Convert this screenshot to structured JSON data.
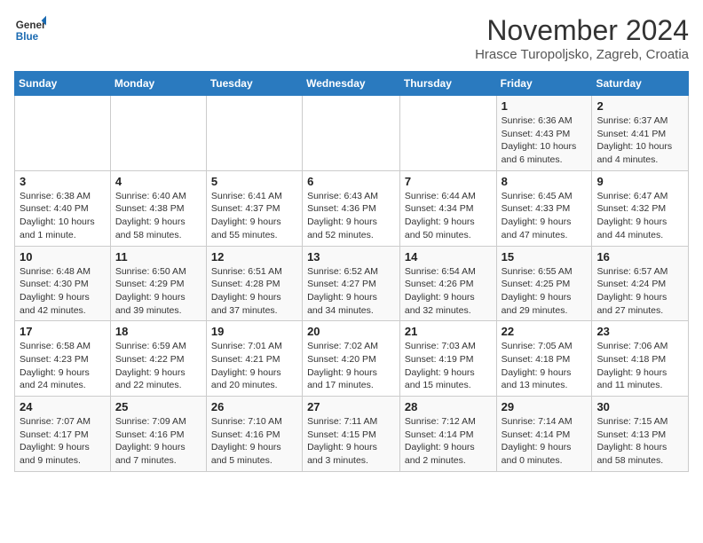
{
  "header": {
    "logo_line1": "General",
    "logo_line2": "Blue",
    "month": "November 2024",
    "location": "Hrasce Turopoljsko, Zagreb, Croatia"
  },
  "days_of_week": [
    "Sunday",
    "Monday",
    "Tuesday",
    "Wednesday",
    "Thursday",
    "Friday",
    "Saturday"
  ],
  "weeks": [
    [
      {
        "day": "",
        "info": ""
      },
      {
        "day": "",
        "info": ""
      },
      {
        "day": "",
        "info": ""
      },
      {
        "day": "",
        "info": ""
      },
      {
        "day": "",
        "info": ""
      },
      {
        "day": "1",
        "info": "Sunrise: 6:36 AM\nSunset: 4:43 PM\nDaylight: 10 hours and 6 minutes."
      },
      {
        "day": "2",
        "info": "Sunrise: 6:37 AM\nSunset: 4:41 PM\nDaylight: 10 hours and 4 minutes."
      }
    ],
    [
      {
        "day": "3",
        "info": "Sunrise: 6:38 AM\nSunset: 4:40 PM\nDaylight: 10 hours and 1 minute."
      },
      {
        "day": "4",
        "info": "Sunrise: 6:40 AM\nSunset: 4:38 PM\nDaylight: 9 hours and 58 minutes."
      },
      {
        "day": "5",
        "info": "Sunrise: 6:41 AM\nSunset: 4:37 PM\nDaylight: 9 hours and 55 minutes."
      },
      {
        "day": "6",
        "info": "Sunrise: 6:43 AM\nSunset: 4:36 PM\nDaylight: 9 hours and 52 minutes."
      },
      {
        "day": "7",
        "info": "Sunrise: 6:44 AM\nSunset: 4:34 PM\nDaylight: 9 hours and 50 minutes."
      },
      {
        "day": "8",
        "info": "Sunrise: 6:45 AM\nSunset: 4:33 PM\nDaylight: 9 hours and 47 minutes."
      },
      {
        "day": "9",
        "info": "Sunrise: 6:47 AM\nSunset: 4:32 PM\nDaylight: 9 hours and 44 minutes."
      }
    ],
    [
      {
        "day": "10",
        "info": "Sunrise: 6:48 AM\nSunset: 4:30 PM\nDaylight: 9 hours and 42 minutes."
      },
      {
        "day": "11",
        "info": "Sunrise: 6:50 AM\nSunset: 4:29 PM\nDaylight: 9 hours and 39 minutes."
      },
      {
        "day": "12",
        "info": "Sunrise: 6:51 AM\nSunset: 4:28 PM\nDaylight: 9 hours and 37 minutes."
      },
      {
        "day": "13",
        "info": "Sunrise: 6:52 AM\nSunset: 4:27 PM\nDaylight: 9 hours and 34 minutes."
      },
      {
        "day": "14",
        "info": "Sunrise: 6:54 AM\nSunset: 4:26 PM\nDaylight: 9 hours and 32 minutes."
      },
      {
        "day": "15",
        "info": "Sunrise: 6:55 AM\nSunset: 4:25 PM\nDaylight: 9 hours and 29 minutes."
      },
      {
        "day": "16",
        "info": "Sunrise: 6:57 AM\nSunset: 4:24 PM\nDaylight: 9 hours and 27 minutes."
      }
    ],
    [
      {
        "day": "17",
        "info": "Sunrise: 6:58 AM\nSunset: 4:23 PM\nDaylight: 9 hours and 24 minutes."
      },
      {
        "day": "18",
        "info": "Sunrise: 6:59 AM\nSunset: 4:22 PM\nDaylight: 9 hours and 22 minutes."
      },
      {
        "day": "19",
        "info": "Sunrise: 7:01 AM\nSunset: 4:21 PM\nDaylight: 9 hours and 20 minutes."
      },
      {
        "day": "20",
        "info": "Sunrise: 7:02 AM\nSunset: 4:20 PM\nDaylight: 9 hours and 17 minutes."
      },
      {
        "day": "21",
        "info": "Sunrise: 7:03 AM\nSunset: 4:19 PM\nDaylight: 9 hours and 15 minutes."
      },
      {
        "day": "22",
        "info": "Sunrise: 7:05 AM\nSunset: 4:18 PM\nDaylight: 9 hours and 13 minutes."
      },
      {
        "day": "23",
        "info": "Sunrise: 7:06 AM\nSunset: 4:18 PM\nDaylight: 9 hours and 11 minutes."
      }
    ],
    [
      {
        "day": "24",
        "info": "Sunrise: 7:07 AM\nSunset: 4:17 PM\nDaylight: 9 hours and 9 minutes."
      },
      {
        "day": "25",
        "info": "Sunrise: 7:09 AM\nSunset: 4:16 PM\nDaylight: 9 hours and 7 minutes."
      },
      {
        "day": "26",
        "info": "Sunrise: 7:10 AM\nSunset: 4:16 PM\nDaylight: 9 hours and 5 minutes."
      },
      {
        "day": "27",
        "info": "Sunrise: 7:11 AM\nSunset: 4:15 PM\nDaylight: 9 hours and 3 minutes."
      },
      {
        "day": "28",
        "info": "Sunrise: 7:12 AM\nSunset: 4:14 PM\nDaylight: 9 hours and 2 minutes."
      },
      {
        "day": "29",
        "info": "Sunrise: 7:14 AM\nSunset: 4:14 PM\nDaylight: 9 hours and 0 minutes."
      },
      {
        "day": "30",
        "info": "Sunrise: 7:15 AM\nSunset: 4:13 PM\nDaylight: 8 hours and 58 minutes."
      }
    ]
  ]
}
